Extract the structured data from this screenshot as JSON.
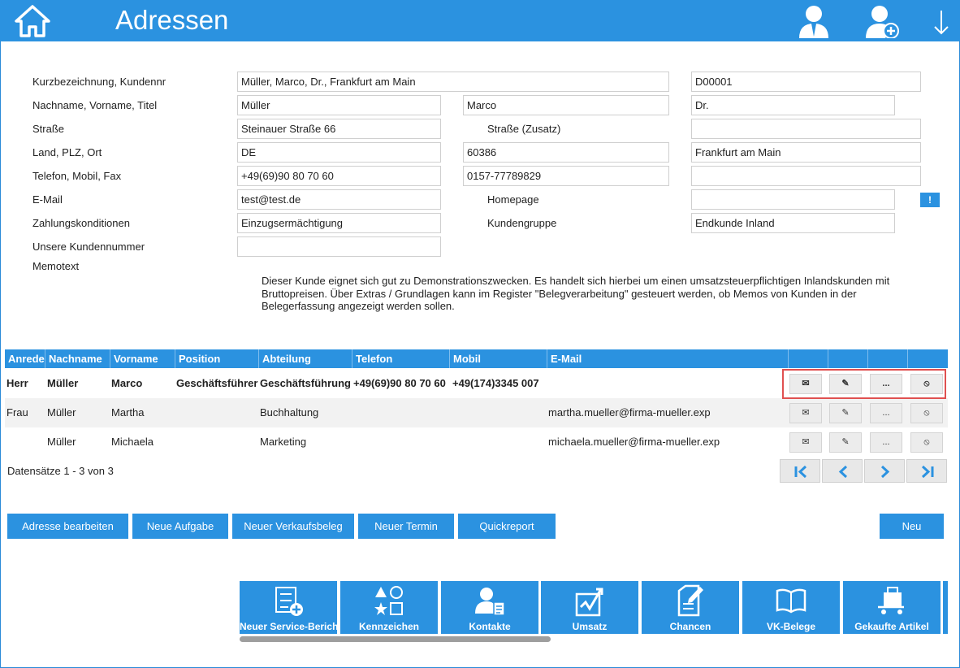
{
  "header": {
    "title": "Adressen"
  },
  "form": {
    "labels": {
      "short": "Kurzbezeichnung, Kundennr",
      "name": "Nachname, Vorname, Titel",
      "street": "Straße",
      "street_extra": "Straße (Zusatz)",
      "location": "Land, PLZ, Ort",
      "phone": "Telefon, Mobil, Fax",
      "email": "E-Mail",
      "homepage": "Homepage",
      "payment": "Zahlungskonditionen",
      "customer_group": "Kundengruppe",
      "our_number": "Unsere Kundennummer",
      "memo": "Memotext"
    },
    "values": {
      "short": "Müller, Marco, Dr., Frankfurt am Main",
      "customer_no": "D00001",
      "last_name": "Müller",
      "first_name": "Marco",
      "title": "Dr.",
      "street": "Steinauer Straße 66",
      "street_extra": "",
      "country": "DE",
      "zip": "60386",
      "city": "Frankfurt am Main",
      "phone": "+49(69)90 80 70 60",
      "mobile": "0157-77789829",
      "fax": "",
      "email": "test@test.de",
      "homepage": "",
      "payment": "Einzugsermächtigung",
      "customer_group": "Endkunde Inland",
      "our_number": ""
    },
    "homepage_button": "!",
    "memo_text": "Dieser Kunde eignet sich gut zu Demonstrationszwecken. Es handelt sich hierbei um einen umsatzsteuerpflichtigen Inlandskunden mit Bruttopreisen. Über Extras / Grundlagen kann im Register \"Belegverarbeitung\" gesteuert werden, ob Memos von Kunden in der Belegerfassung angezeigt werden sollen."
  },
  "table": {
    "columns": [
      "Anrede",
      "Nachname",
      "Vorname",
      "Position",
      "Abteilung",
      "Telefon",
      "Mobil",
      "E-Mail",
      "",
      "",
      "",
      ""
    ],
    "rows": [
      {
        "anrede": "Herr",
        "nachname": "Müller",
        "vorname": "Marco",
        "position": "Geschäftsführer",
        "abteilung": "Geschäftsführung",
        "telefon": "+49(69)90 80 70 60",
        "mobil": "+49(174)3345 007",
        "email": ""
      },
      {
        "anrede": "Frau",
        "nachname": "Müller",
        "vorname": "Martha",
        "position": "",
        "abteilung": "Buchhaltung",
        "telefon": "",
        "mobil": "",
        "email": "martha.mueller@firma-mueller.exp"
      },
      {
        "anrede": "",
        "nachname": "Müller",
        "vorname": "Michaela",
        "position": "",
        "abteilung": "Marketing",
        "telefon": "",
        "mobil": "",
        "email": "michaela.mueller@firma-mueller.exp"
      }
    ],
    "row_actions": {
      "mail": "✉",
      "edit": "✎",
      "more": "...",
      "delete": "⦸"
    },
    "record_info": "Datensätze 1 - 3 von 3"
  },
  "buttons": {
    "edit_address": "Adresse bearbeiten",
    "new_task": "Neue Aufgabe",
    "new_sales_doc": "Neuer Verkaufsbeleg",
    "new_appointment": "Neuer Termin",
    "quickreport": "Quickreport",
    "new": "Neu"
  },
  "tiles": [
    {
      "label": "Neuer Service-Bericht",
      "icon": "service-report-icon"
    },
    {
      "label": "Kennzeichen",
      "icon": "shapes-icon"
    },
    {
      "label": "Kontakte",
      "icon": "contact-icon"
    },
    {
      "label": "Umsatz",
      "icon": "chart-icon"
    },
    {
      "label": "Chancen",
      "icon": "edit-document-icon"
    },
    {
      "label": "VK-Belege",
      "icon": "book-icon"
    },
    {
      "label": "Gekaufte Artikel",
      "icon": "cart-icon"
    }
  ],
  "colors": {
    "accent": "#2b92e0",
    "highlight": "#e05050"
  }
}
